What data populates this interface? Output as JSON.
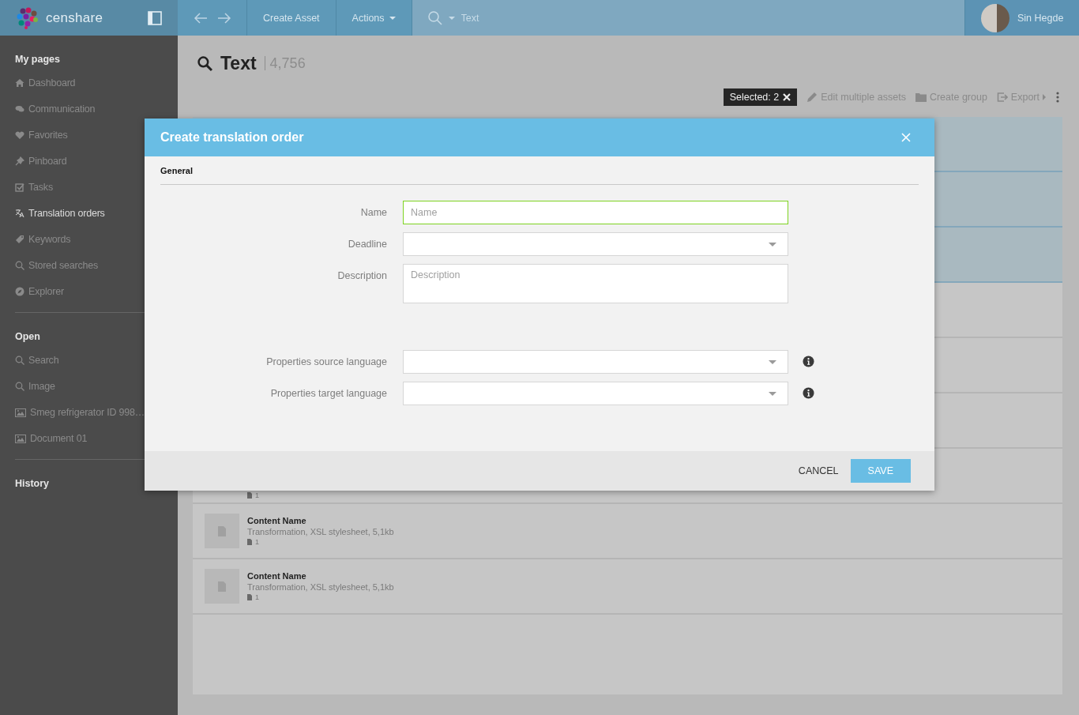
{
  "header": {
    "logo": "censhare",
    "nav": [
      {
        "label": "Create Asset",
        "kind": "button"
      },
      {
        "label": "Actions",
        "kind": "menu"
      }
    ],
    "search": {
      "placeholder": "Text"
    },
    "user": "Sin Hegde"
  },
  "sidebar": {
    "sections": [
      {
        "title": "My pages",
        "items": [
          {
            "label": "Dashboard",
            "selected": false
          },
          {
            "label": "Communication",
            "selected": false
          },
          {
            "label": "Favorites",
            "selected": false
          },
          {
            "label": "Pinboard",
            "selected": false
          },
          {
            "label": "Tasks",
            "selected": false
          },
          {
            "label": "Translation orders",
            "selected": true
          },
          {
            "label": "Keywords",
            "selected": false
          },
          {
            "label": "Stored searches",
            "selected": false
          },
          {
            "label": "Explorer",
            "selected": false
          }
        ]
      },
      {
        "title": "Open",
        "items": [
          {
            "label": "Search",
            "selected": false
          },
          {
            "label": "Image",
            "selected": false
          },
          {
            "label": "Smeg refrigerator ID 998…",
            "selected": false
          },
          {
            "label": "Document 01",
            "selected": false
          }
        ]
      },
      {
        "title": "History"
      }
    ]
  },
  "page": {
    "title": "Text",
    "count": "4,756",
    "selection": "Selected: 2",
    "actions": [
      "Edit multiple assets",
      "Create group",
      "Export"
    ]
  },
  "results": [
    {
      "selected": true
    },
    {
      "selected": true
    },
    {
      "selected": true
    },
    {
      "selected": false
    },
    {
      "selected": false
    },
    {
      "selected": false
    },
    {
      "selected": false,
      "count": "1"
    },
    {
      "selected": false,
      "name": "Content Name",
      "detail": "Transformation, XSL stylesheet, 5,1kb",
      "count": "1"
    },
    {
      "selected": false,
      "name": "Content Name",
      "detail": "Transformation, XSL stylesheet, 5,1kb",
      "count": "1"
    }
  ],
  "dialog": {
    "title": "Create translation order",
    "tab": "General",
    "groups": [
      [
        {
          "label": "Name",
          "kind": "text",
          "placeholder": "Name",
          "focused": true
        },
        {
          "label": "Deadline",
          "kind": "select",
          "focused": false
        },
        {
          "label": "Description",
          "kind": "textarea",
          "placeholder": "Description",
          "focused": false
        }
      ],
      [
        {
          "label": "Properties source language",
          "kind": "select",
          "focused": false,
          "info": true
        },
        {
          "label": "Properties target language",
          "kind": "select",
          "focused": false,
          "info": true
        }
      ]
    ],
    "buttons": [
      {
        "label": "CANCEL",
        "kind": "secondary"
      },
      {
        "label": "SAVE",
        "kind": "primary"
      }
    ]
  }
}
